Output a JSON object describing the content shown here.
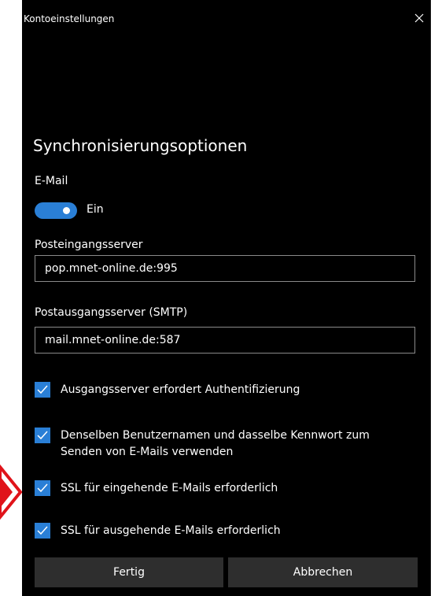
{
  "window": {
    "title": "Kontoeinstellungen",
    "close_icon": "close-icon"
  },
  "heading": "Synchronisierungsoptionen",
  "email": {
    "label": "E-Mail",
    "toggle_state": "Ein",
    "on": true,
    "accent": "#2a7fd6"
  },
  "incoming": {
    "label": "Posteingangsserver",
    "value": "pop.mnet-online.de:995"
  },
  "outgoing": {
    "label": "Postausgangsserver (SMTP)",
    "value": "mail.mnet-online.de:587"
  },
  "checkboxes": [
    {
      "label": "Ausgangsserver erfordert Authentifizierung",
      "checked": true
    },
    {
      "label_line1": "Denselben Benutzernamen und dasselbe Kennwort zum",
      "label_line2": "Senden von E-Mails verwenden",
      "checked": true
    },
    {
      "label": "SSL für eingehende E-Mails erforderlich",
      "checked": true
    },
    {
      "label": "SSL für ausgehende E-Mails erforderlich",
      "checked": true
    }
  ],
  "buttons": {
    "done": "Fertig",
    "cancel": "Abbrechen"
  },
  "annotation": {
    "color": "#e0131a"
  }
}
